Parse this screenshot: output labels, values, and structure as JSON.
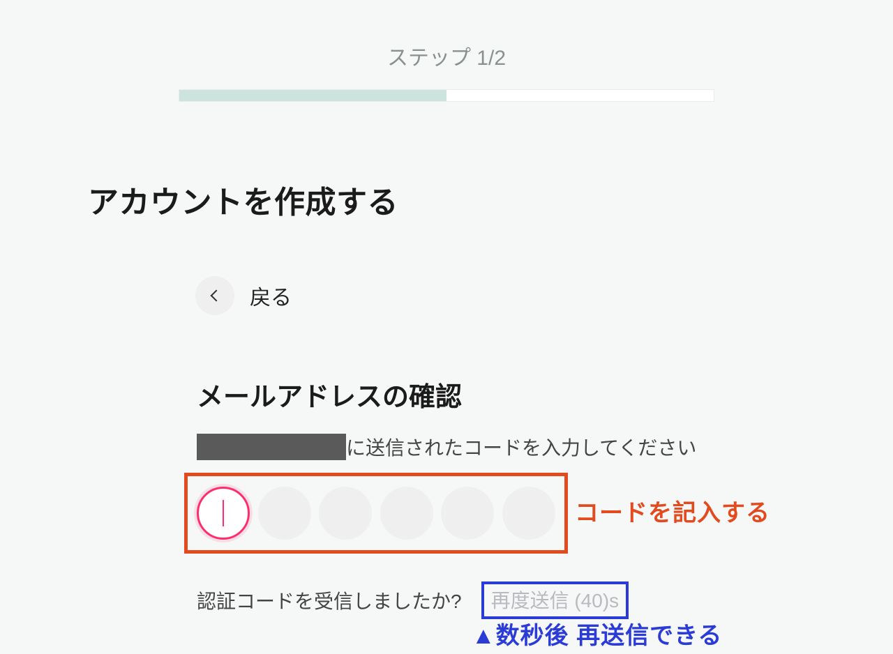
{
  "header": {
    "step_label": "ステップ 1/2",
    "progress_percent": 50
  },
  "title": "アカウントを作成する",
  "back": {
    "label": "戻る"
  },
  "verify": {
    "heading": "メールアドレスの確認",
    "instruction_suffix": "に送信されたコードを入力してください",
    "code_length": 6
  },
  "resend": {
    "question": "認証コードを受信しましたか?",
    "link_text": "再度送信 (40)s",
    "countdown_seconds": 40
  },
  "annotations": {
    "code_label": "コードを記入する",
    "resend_label": "▲数秒後 再送信できる",
    "box_color_code": "#e24a1f",
    "box_color_resend": "#2b3bd6"
  }
}
